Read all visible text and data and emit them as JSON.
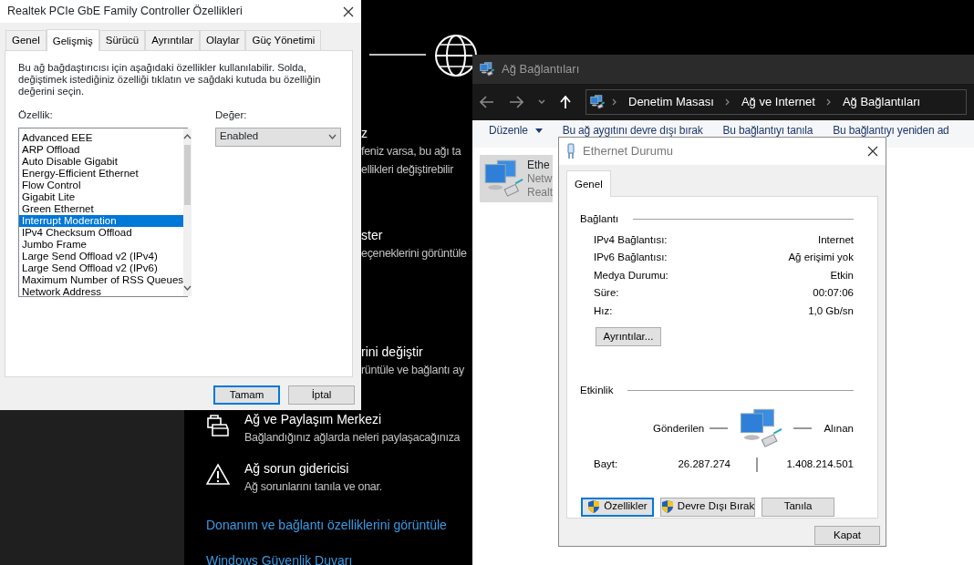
{
  "settings_window": {
    "partial_options": [
      {
        "title": "z",
        "description": [
          "feniz varsa, bu ağı ta",
          "ellikleri değiştirebilir"
        ]
      },
      {
        "title": "ster",
        "description": [
          "eçeneklerini görüntüle"
        ]
      },
      {
        "title": "rini değiştir",
        "description": [
          "rüntüle ve bağlantı ay"
        ]
      }
    ],
    "options": [
      {
        "kind": "sharing",
        "title": "Ağ ve Paylaşım Merkezi",
        "description": "Bağlandığınız ağlarda neleri paylaşacağınıza"
      },
      {
        "kind": "troubleshoot",
        "title": "Ağ sorun gidericisi",
        "description": "Ağ sorunlarını tanıla ve onar."
      }
    ],
    "links": [
      "Donanım ve bağlantı özelliklerini görüntüle",
      "Windows Güvenlik Duvarı"
    ]
  },
  "network_connections": {
    "title": "Ağ Bağlantıları",
    "breadcrumb": [
      "Denetim Masası",
      "Ağ ve Internet",
      "Ağ Bağlantıları"
    ],
    "toolbar": [
      {
        "label": "Düzenle",
        "kind": "menu"
      },
      {
        "label": "Bu ağ aygıtını devre dışı bırak",
        "kind": "action"
      },
      {
        "label": "Bu bağlantıyı tanıla",
        "kind": "action"
      },
      {
        "label": "Bu bağlantıyı yeniden ad",
        "kind": "action"
      }
    ],
    "connection": {
      "name": "Ethe",
      "lines": [
        "Netw",
        "Realt"
      ],
      "selected": true
    }
  },
  "ethernet_status": {
    "title": "Ethernet Durumu",
    "tabs": [
      {
        "label": "Genel",
        "selected": true
      }
    ],
    "connection_heading": "Bağlantı",
    "connection_rows": [
      {
        "label": "IPv4 Bağlantısı:",
        "value": "Internet"
      },
      {
        "label": "IPv6 Bağlantısı:",
        "value": "Ağ erişimi yok"
      },
      {
        "label": "Medya Durumu:",
        "value": "Etkin"
      },
      {
        "label": "Süre:",
        "value": "00:07:06"
      },
      {
        "label": "Hız:",
        "value": "1,0 Gb/sn"
      }
    ],
    "details_button": "Ayrıntılar...",
    "activity_heading": "Etkinlik",
    "sent_label": "Gönderilen",
    "received_label": "Alınan",
    "bytes_label": "Bayt:",
    "bytes_sent": "26.287.274",
    "bytes_received": "1.408.214.501",
    "buttons": [
      {
        "label": "Özellikler",
        "shield": true,
        "selected": true
      },
      {
        "label": "Devre Dışı Bırak",
        "shield": true,
        "selected": false
      },
      {
        "label": "Tanıla",
        "shield": false,
        "selected": false
      }
    ],
    "close_button": "Kapat"
  },
  "adapter_properties": {
    "title": "Realtek PCIe GbE Family Controller Özellikleri",
    "tabs": [
      {
        "label": "Genel",
        "selected": false
      },
      {
        "label": "Gelişmiş",
        "selected": true
      },
      {
        "label": "Sürücü",
        "selected": false
      },
      {
        "label": "Ayrıntılar",
        "selected": false
      },
      {
        "label": "Olaylar",
        "selected": false
      },
      {
        "label": "Güç Yönetimi",
        "selected": false
      }
    ],
    "description": "Bu ağ bağdaştırıcısı için aşağıdaki özellikler kullanılabilir. Solda, değiştimek istediğiniz özelliği tıklatın ve sağdaki kutuda bu özelliğin değerini seçin.",
    "property_label": "Özellik:",
    "value_label": "Değer:",
    "properties": [
      {
        "label": "Advanced EEE",
        "selected": false
      },
      {
        "label": "ARP Offload",
        "selected": false
      },
      {
        "label": "Auto Disable Gigabit",
        "selected": false
      },
      {
        "label": "Energy-Efficient Ethernet",
        "selected": false
      },
      {
        "label": "Flow Control",
        "selected": false
      },
      {
        "label": "Gigabit Lite",
        "selected": false
      },
      {
        "label": "Green Ethernet",
        "selected": false
      },
      {
        "label": "Interrupt Moderation",
        "selected": true
      },
      {
        "label": "IPv4 Checksum Offload",
        "selected": false
      },
      {
        "label": "Jumbo Frame",
        "selected": false
      },
      {
        "label": "Large Send Offload v2 (IPv4)",
        "selected": false
      },
      {
        "label": "Large Send Offload v2 (IPv6)",
        "selected": false
      },
      {
        "label": "Maximum Number of RSS Queues",
        "selected": false
      },
      {
        "label": "Network Address",
        "selected": false
      }
    ],
    "value": "Enabled",
    "buttons": [
      {
        "label": "Tamam",
        "selected": true
      },
      {
        "label": "İptal",
        "selected": false
      }
    ]
  }
}
